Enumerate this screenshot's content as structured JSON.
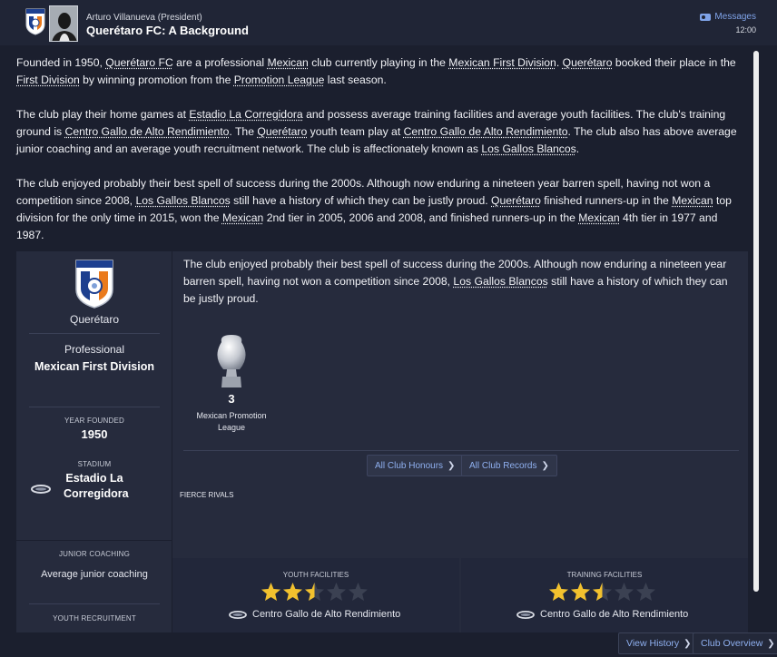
{
  "header": {
    "sender_name": "Arturo Villanueva",
    "sender_role": "(President)",
    "subject": "Querétaro FC: A Background",
    "messages_label": "Messages",
    "time": "12:00"
  },
  "intro": {
    "p1": [
      {
        "t": "Founded in 1950, "
      },
      {
        "t": "Querétaro FC",
        "link": true
      },
      {
        "t": " are a professional "
      },
      {
        "t": "Mexican",
        "link": true
      },
      {
        "t": " club currently playing in the "
      },
      {
        "t": "Mexican First Division",
        "link": true
      },
      {
        "t": ". "
      },
      {
        "t": "Querétaro",
        "link": true
      },
      {
        "t": " booked their place in the "
      },
      {
        "t": "First Division",
        "link": true
      },
      {
        "t": " by winning promotion from the "
      },
      {
        "t": "Promotion League",
        "link": true
      },
      {
        "t": " last season."
      }
    ],
    "p2": [
      {
        "t": "The club play their home games at "
      },
      {
        "t": "Estadio La Corregidora",
        "link": true
      },
      {
        "t": " and possess average training facilities and average youth facilities. The club's training ground is "
      },
      {
        "t": "Centro Gallo de Alto Rendimiento",
        "link": true
      },
      {
        "t": ". The "
      },
      {
        "t": "Querétaro",
        "link": true
      },
      {
        "t": " youth team play at "
      },
      {
        "t": "Centro Gallo de Alto Rendimiento",
        "link": true
      },
      {
        "t": ". The club also has above average junior coaching and an average youth recruitment network. The club is affectionately known as "
      },
      {
        "t": "Los Gallos Blancos",
        "link": true
      },
      {
        "t": "."
      }
    ],
    "p3": [
      {
        "t": "The club enjoyed probably their best spell of success during the 2000s. Although now enduring a nineteen year barren spell, having not won a competition since 2008, "
      },
      {
        "t": "Los Gallos Blancos",
        "link": true
      },
      {
        "t": " still have a history of which they can be justly proud.  "
      },
      {
        "t": "Querétaro",
        "link": true
      },
      {
        "t": " finished runners-up in the "
      },
      {
        "t": "Mexican",
        "link": true
      },
      {
        "t": " top division for the only time in 2015, won the "
      },
      {
        "t": "Mexican",
        "link": true
      },
      {
        "t": " 2nd tier in 2005, 2006 and 2008, and finished runners-up in the "
      },
      {
        "t": "Mexican",
        "link": true
      },
      {
        "t": " 4th tier in 1977 and 1987."
      }
    ]
  },
  "club": {
    "name": "Querétaro",
    "status": "Professional",
    "division": "Mexican First Division",
    "year_founded_label": "YEAR FOUNDED",
    "year_founded": "1950",
    "stadium_label": "STADIUM",
    "stadium_name": "Estadio La Corregidora",
    "junior_coaching_label": "JUNIOR COACHING",
    "junior_coaching": "Average junior coaching",
    "youth_recruitment_label": "YOUTH RECRUITMENT"
  },
  "history_quote": [
    {
      "t": "The club enjoyed probably their best spell of success during the 2000s. Although now enduring a nineteen year barren spell, having not won a competition since 2008, "
    },
    {
      "t": "Los Gallos Blancos",
      "link": true
    },
    {
      "t": " still have a history of which they can be justly proud."
    }
  ],
  "honours": {
    "trophy_count": "3",
    "trophy_name": "Mexican Promotion League",
    "all_honours_label": "All Club Honours",
    "all_records_label": "All Club Records"
  },
  "fierce_rivals_label": "FIERCE RIVALS",
  "facilities": {
    "youth": {
      "label": "YOUTH FACILITIES",
      "stars": 2.5,
      "name": "Centro Gallo de Alto Rendimiento"
    },
    "training": {
      "label": "TRAINING FACILITIES",
      "stars": 2.5,
      "name": "Centro Gallo de Alto Rendimiento"
    }
  },
  "footer": {
    "view_history_label": "View History",
    "club_overview_label": "Club Overview"
  },
  "colors": {
    "background": "#1b1f2e",
    "panel": "#262b3d",
    "link_blue": "#8fb0f0",
    "star_gold": "#f2c12e",
    "star_empty": "#3b4152"
  }
}
